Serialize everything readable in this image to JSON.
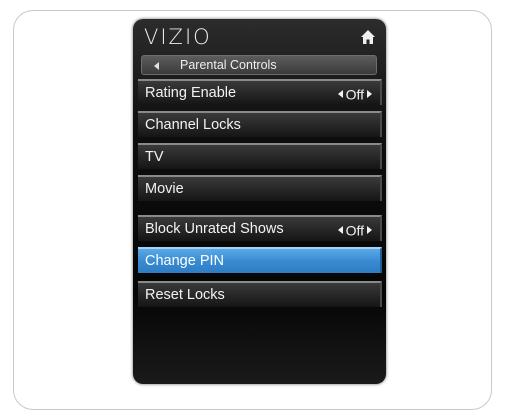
{
  "header": {
    "logo_text": "VIZIO",
    "home_icon": "home-icon"
  },
  "subheader": {
    "title": "Parental Controls",
    "back_icon": "left-arrow-icon"
  },
  "menu": {
    "items": [
      {
        "label": "Rating Enable",
        "value": "Off",
        "selected": false
      },
      {
        "label": "Channel Locks",
        "selected": false
      },
      {
        "label": "TV",
        "selected": false
      },
      {
        "label": "Movie",
        "selected": false
      },
      {
        "label": "Block Unrated Shows",
        "value": "Off",
        "selected": false
      },
      {
        "label": "Change PIN",
        "selected": true
      },
      {
        "label": "Reset Locks",
        "selected": false
      }
    ]
  },
  "colors": {
    "selected_row": "#3a8cd2",
    "panel_bg": "#0f0f0f",
    "row_text": "#f2f2f2"
  }
}
